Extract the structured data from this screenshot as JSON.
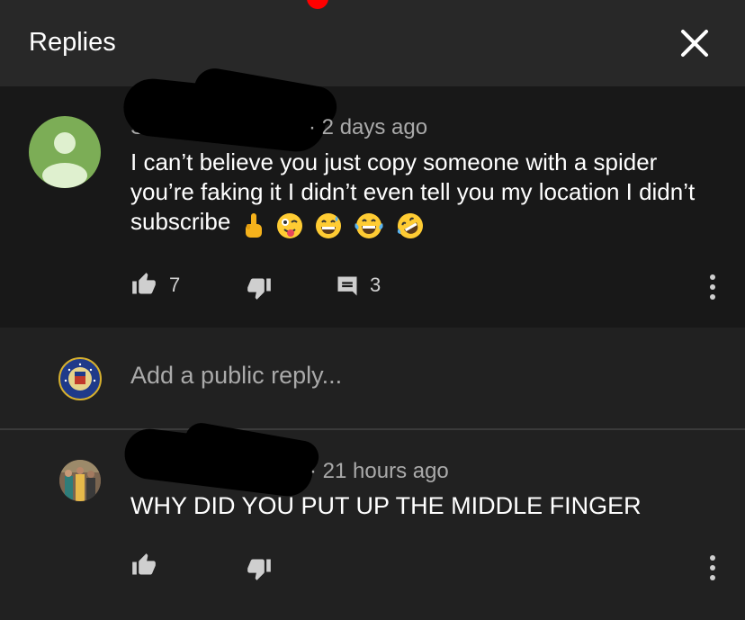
{
  "header": {
    "title": "Replies",
    "close_icon": "close-icon",
    "accent": "#ff0000"
  },
  "comment": {
    "author_visible": "S",
    "time": "2 days ago",
    "text": "I can’t believe you just copy someone with a spider you’re faking it I didn’t even tell you my location I didn’t subscribe",
    "emojis": [
      "middle-finger",
      "winking-tongue",
      "grinning-sweat",
      "tears-of-joy",
      "rolling-laughing"
    ],
    "likes": "7",
    "reply_count": "3"
  },
  "reply_box": {
    "placeholder": "Add a public reply..."
  },
  "reply": {
    "time": "21 hours ago",
    "text": "WHY DID YOU PUT UP THE MIDDLE FINGER"
  },
  "colors": {
    "default_avatar": "#7cad56",
    "panel": "#181818",
    "background": "#212121",
    "header": "#282828"
  }
}
